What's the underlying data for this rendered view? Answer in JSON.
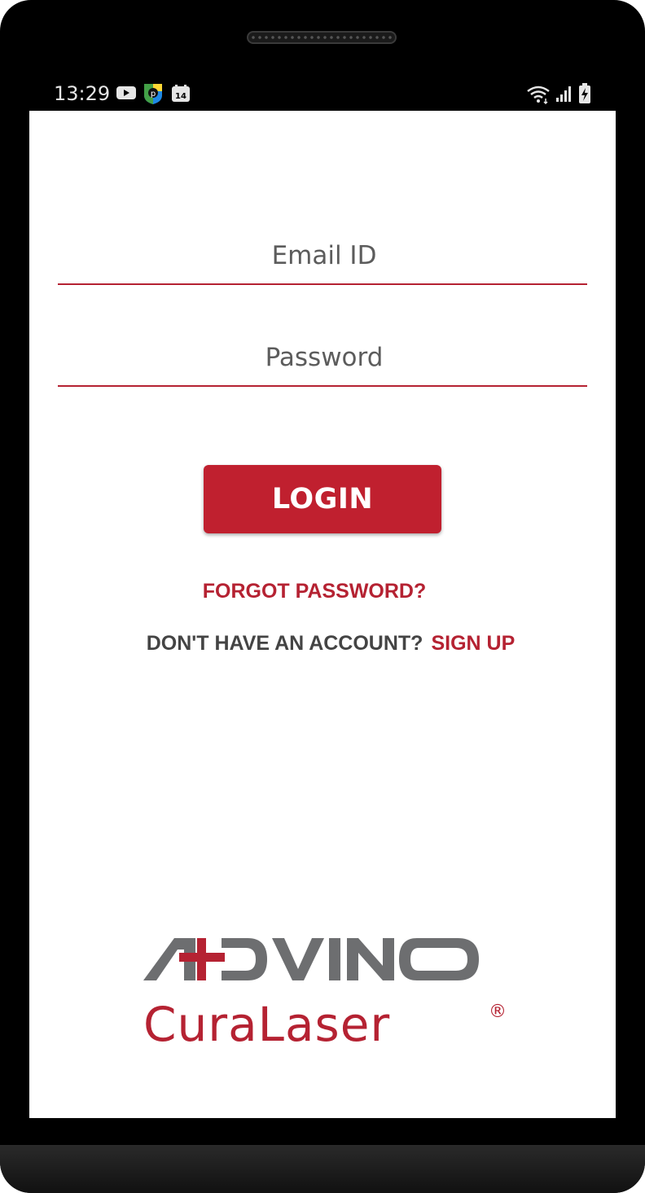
{
  "status_bar": {
    "time": "13:29",
    "calendar_day": "14",
    "icons": [
      "youtube-icon",
      "app-icon",
      "calendar-icon",
      "wifi-icon",
      "signal-icon",
      "battery-charging-icon"
    ]
  },
  "form": {
    "email_placeholder": "Email ID",
    "email_value": "",
    "password_placeholder": "Password",
    "password_value": ""
  },
  "actions": {
    "login_label": "LOGIN",
    "forgot_label": "FORGOT PASSWORD?",
    "signup_prompt": "DON'T HAVE AN ACCOUNT?",
    "signup_label": "SIGN UP"
  },
  "logo": {
    "brand": "ADVINO",
    "product": "CuraLaser",
    "registered": "®"
  },
  "colors": {
    "accent": "#c0202f",
    "link": "#b52232",
    "text_dark": "#444444",
    "logo_gray": "#6d6e70"
  }
}
